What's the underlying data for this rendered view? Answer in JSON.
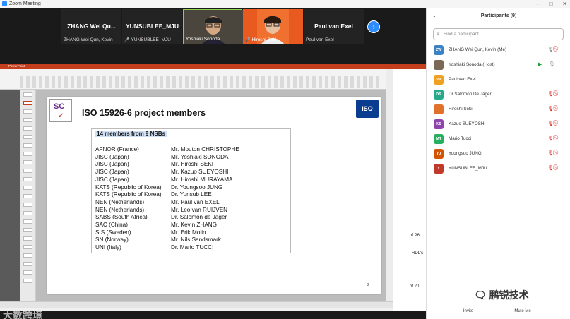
{
  "window": {
    "title": "Zoom Meeting"
  },
  "gallery": {
    "tiles": [
      {
        "display_name": "ZHANG Wei Qu...",
        "label": "ZHANG Wei Qun, Kevin",
        "muted": false
      },
      {
        "display_name": "YUNSUBLEE_MJU",
        "label": "YUNSUBLEE_MJU",
        "muted": true
      },
      {
        "display_name": "",
        "label": "Yoshiaki Sonoda",
        "muted": false
      },
      {
        "display_name": "",
        "label": "Hiroshi Seki",
        "muted": true
      },
      {
        "display_name": "Paul van Exel",
        "label": "Paul van Exel",
        "muted": false
      }
    ],
    "next_icon": "chevron-right-icon"
  },
  "slide": {
    "title": "ISO 15926-6 project members",
    "subtitle": "14 members from 9 NSBs",
    "logo_left": "SC",
    "logo_right": "ISO",
    "page_number": "2",
    "members": [
      {
        "org": "AFNOR (France)",
        "name": "Mr. Mouton CHRISTOPHE"
      },
      {
        "org": "JISC (Japan)",
        "name": "Mr. Yoshiaki SONODA"
      },
      {
        "org": "JISC (Japan)",
        "name": "Mr. Hiroshi SEKI"
      },
      {
        "org": "JISC (Japan)",
        "name": "Mr. Kazuo SUEYOSHI"
      },
      {
        "org": "JISC (Japan)",
        "name": "Mr. Hiroshi MURAYAMA"
      },
      {
        "org": "KATS (Republic of Korea)",
        "name": "Dr. Youngsoo JUNG"
      },
      {
        "org": "KATS (Republic of Korea)",
        "name": "Dr. Yunsub LEE"
      },
      {
        "org": "NEN (Netherlands)",
        "name": "Mr. Paul van EXEL"
      },
      {
        "org": "NEN (Netherlands)",
        "name": "Mr. Leo van RUIJVEN"
      },
      {
        "org": "SABS (South Africa)",
        "name": "Dr. Salomon de Jager"
      },
      {
        "org": "SAC (China)",
        "name": "Mr. Kevin ZHANG"
      },
      {
        "org": "SIS (Sweden)",
        "name": "Mr. Erik Molin"
      },
      {
        "org": "SN (Norway)",
        "name": "Mr. Nils Sandsmark"
      },
      {
        "org": "UNI (Italy)",
        "name": "Dr. Mario TUCCI"
      }
    ]
  },
  "behind_window": {
    "snippets": [
      "of P6",
      "l RDL's",
      "of 20"
    ]
  },
  "watermark": {
    "text": "大数跨境"
  },
  "wechat": {
    "text": "鹏锐技术"
  },
  "participants": {
    "header": "Participants (9)",
    "search_placeholder": "Find a participant",
    "list": [
      {
        "initials": "ZW",
        "name": "ZHANG Wei Qun, Kevin (Me)",
        "color": "#3b82c4",
        "mic": "on",
        "video": "off"
      },
      {
        "initials": "",
        "name": "Yoshiaki Sonoda (Host)",
        "color": "#7a6a55",
        "mic": "on",
        "video": "on"
      },
      {
        "initials": "PV",
        "name": "Paul van Exel",
        "color": "#f0a020",
        "mic": "none",
        "video": "none"
      },
      {
        "initials": "DS",
        "name": "Dr Salomon De Jager",
        "color": "#27a88a",
        "mic": "off",
        "video": "off"
      },
      {
        "initials": "",
        "name": "Hiroshi Seki",
        "color": "#e0702a",
        "mic": "off",
        "video": "off"
      },
      {
        "initials": "KS",
        "name": "Kazuo SUEYOSHI",
        "color": "#8e44ad",
        "mic": "off",
        "video": "off"
      },
      {
        "initials": "MT",
        "name": "Mario Tucci",
        "color": "#27ae60",
        "mic": "off",
        "video": "off"
      },
      {
        "initials": "YJ",
        "name": "Youngsoo JUNG",
        "color": "#d35400",
        "mic": "off",
        "video": "off"
      },
      {
        "initials": "Y",
        "name": "YUNSUBLEE_MJU",
        "color": "#c0392b",
        "mic": "off",
        "video": "off"
      }
    ],
    "invite_label": "Invite",
    "mute_all_label": "Mute Me"
  }
}
